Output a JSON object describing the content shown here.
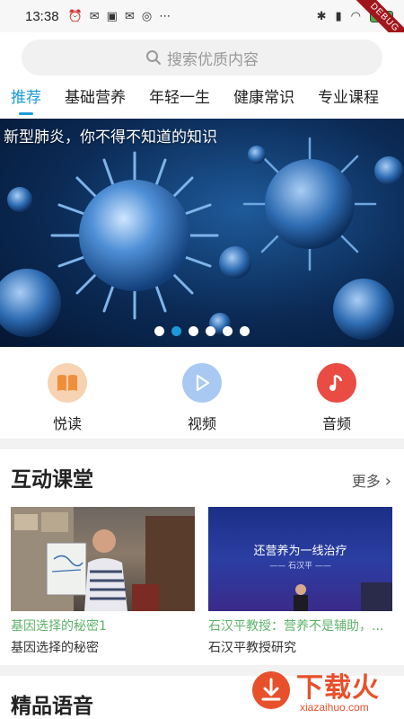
{
  "status_bar": {
    "time": "13:38",
    "battery": "57",
    "debug_label": "DEBUG"
  },
  "search": {
    "placeholder": "搜索优质内容"
  },
  "tabs": [
    {
      "label": "推荐",
      "active": true
    },
    {
      "label": "基础营养",
      "active": false
    },
    {
      "label": "年轻一生",
      "active": false
    },
    {
      "label": "健康常识",
      "active": false
    },
    {
      "label": "专业课程",
      "active": false
    }
  ],
  "banner": {
    "title": "新型肺炎，你不得不知道的知识",
    "dot_count": 6,
    "active_dot": 1
  },
  "quick_actions": [
    {
      "label": "悦读",
      "icon": "book-icon",
      "color": "#f6c9a6"
    },
    {
      "label": "视频",
      "icon": "play-icon",
      "color": "#a9c9f2"
    },
    {
      "label": "音频",
      "icon": "music-note-icon",
      "color": "#ea4b43"
    }
  ],
  "interactive_class": {
    "title": "互动课堂",
    "more": "更多",
    "cards": [
      {
        "title": "基因选择的秘密1",
        "subtitle": "基因选择的秘密",
        "thumb_text": ""
      },
      {
        "title": "石汉平教授：营养不是辅助，...",
        "subtitle": "石汉平教授研究",
        "thumb_text": "还营养为一线治疗",
        "thumb_sub": "—— 石汉平 ——"
      }
    ]
  },
  "audio_section": {
    "title": "精品语音"
  },
  "watermark": {
    "brand": "下载火",
    "domain": "xiazaihuo.com"
  },
  "colors": {
    "accent": "#1a9bd7",
    "card_title": "#5fb36a",
    "watermark": "#e8502b"
  }
}
